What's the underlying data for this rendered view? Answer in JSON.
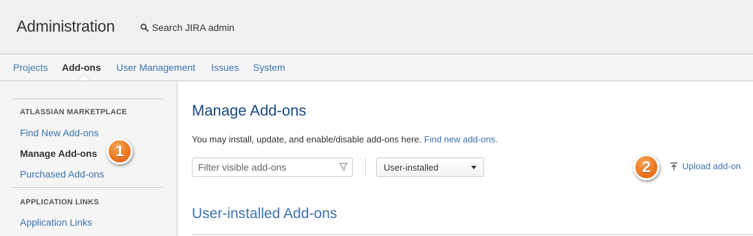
{
  "header": {
    "title": "Administration",
    "search_label": "Search JIRA admin"
  },
  "nav": {
    "tabs": [
      {
        "label": "Projects",
        "active": false
      },
      {
        "label": "Add-ons",
        "active": true
      },
      {
        "label": "User Management",
        "active": false
      },
      {
        "label": "Issues",
        "active": false
      },
      {
        "label": "System",
        "active": false
      }
    ]
  },
  "sidebar": {
    "sections": [
      {
        "heading": "ATLASSIAN MARKETPLACE",
        "items": [
          {
            "label": "Find New Add-ons",
            "current": false
          },
          {
            "label": "Manage Add-ons",
            "current": true
          },
          {
            "label": "Purchased Add-ons",
            "current": false
          }
        ]
      },
      {
        "heading": "APPLICATION LINKS",
        "items": [
          {
            "label": "Application Links",
            "current": false
          }
        ]
      }
    ]
  },
  "main": {
    "title": "Manage Add-ons",
    "description": "You may install, update, and enable/disable add-ons here.",
    "description_link": "Find new add-ons.",
    "filter_placeholder": "Filter visible add-ons",
    "type_select": "User-installed",
    "upload_label": "Upload add-on",
    "section_title": "User-installed Add-ons"
  },
  "callouts": {
    "first": "1",
    "second": "2"
  },
  "colors": {
    "link": "#3b73af",
    "title": "#1a4a80",
    "callout": "#ee7c25"
  }
}
